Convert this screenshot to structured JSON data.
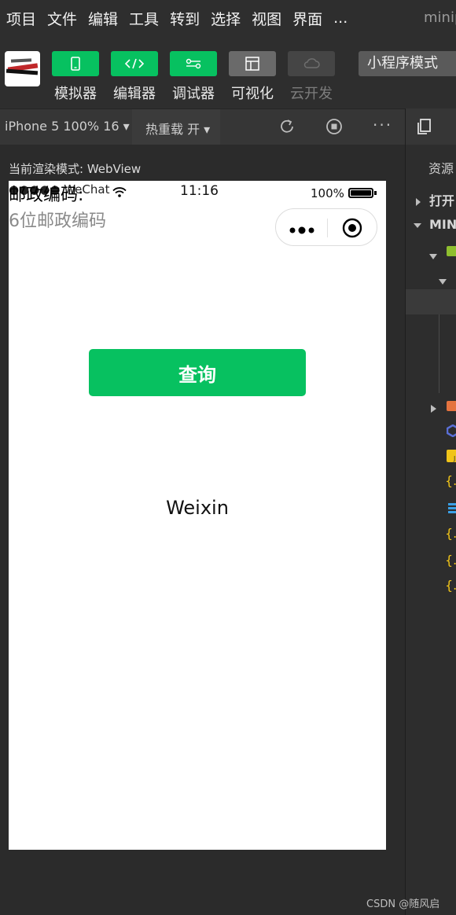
{
  "menu": {
    "items": [
      "项目",
      "文件",
      "编辑",
      "工具",
      "转到",
      "选择",
      "视图",
      "界面",
      "..."
    ],
    "window_title": "minip"
  },
  "toolbar": {
    "tools": [
      {
        "label": "模拟器",
        "icon": "phone-icon",
        "state": "active"
      },
      {
        "label": "编辑器",
        "icon": "code-icon",
        "state": "active"
      },
      {
        "label": "调试器",
        "icon": "debug-icon",
        "state": "active"
      },
      {
        "label": "可视化",
        "icon": "layout-icon",
        "state": "normal"
      },
      {
        "label": "云开发",
        "icon": "cloud-icon",
        "state": "disabled"
      }
    ],
    "mode_select": "小程序模式",
    "accent_color": "#07c160"
  },
  "simulator": {
    "device": "iPhone 5 100% 16 ▾",
    "hot_reload": "热重载 开 ▾",
    "render_mode": "当前渲染模式: WebView",
    "status_bar": {
      "carrier": "●●●●● WeChat",
      "time": "11:16",
      "battery": "100%"
    },
    "page": {
      "field_label": "邮政编码:",
      "input_placeholder": "6位邮政编码",
      "query_button": "查询",
      "result": "Weixin"
    }
  },
  "right_panel": {
    "resource_label": "资源",
    "sections": [
      "打开",
      "MINI"
    ]
  },
  "watermark": "CSDN @随风启"
}
